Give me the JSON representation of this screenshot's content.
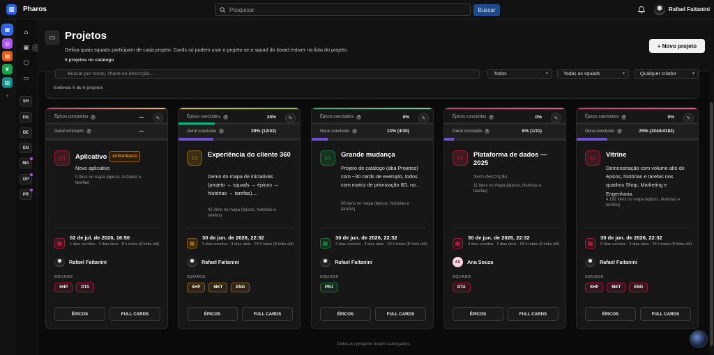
{
  "app": {
    "name": "Pharos"
  },
  "search": {
    "placeholder": "Pesquisar",
    "button_label": "Buscar"
  },
  "user": {
    "name": "Rafael Faitanini"
  },
  "squad_shortcuts": [
    {
      "label": "SH",
      "dot": false
    },
    {
      "label": "D&",
      "dot": false
    },
    {
      "label": "DE",
      "dot": false
    },
    {
      "label": "EN",
      "dot": false
    },
    {
      "label": "MA",
      "dot": true
    },
    {
      "label": "OP",
      "dot": true
    },
    {
      "label": "PR",
      "dot": true
    }
  ],
  "header": {
    "title": "Projetos",
    "description": "Defina quais squads participam de cada projeto. Cards só podem usar o projeto se a squad do board estiver na lista do projeto.",
    "count": "5 projetos no catálogo",
    "new_button": "+ Novo projeto"
  },
  "filters": {
    "search_placeholder": "Buscar por nome, chave ou descrição...",
    "status": "Todos",
    "squads": "Todas as squads",
    "owner": "Qualquer criador",
    "count_text": "Exibindo 5 de 5 projetos"
  },
  "labels": {
    "epics_done": "Épicos concluídos",
    "overall_done": "Geral concluído",
    "squads": "SQUADS",
    "epics_button": "ÉPICOS",
    "full_cards_button": "FULL CARDS"
  },
  "projects": [
    {
      "title": "Aplicativo",
      "badge": "ESTRATÉGICO",
      "epics_pct": "—",
      "epics_fill": 0,
      "overall_pct": "—",
      "overall_fill": 0,
      "description": "Novo aplicativo",
      "description_muted": false,
      "items": "0 itens no mapa (épicos, histórias e tarefas)",
      "date": "02 de jul. de 2026, 16:50",
      "date_sub": "1 dias corridos · 1 dias úteis · 8 h totais (8 h/dia útil)",
      "owner": "Rafael Faitanini",
      "owner_initials": "",
      "tags": [
        "SHP",
        "DTA"
      ],
      "accent": "#e11d48",
      "stripe": "linear-gradient(90deg,#b8456a,#e8b86a)"
    },
    {
      "title": "Experiência do cliente 360",
      "badge": "",
      "epics_pct": "30%",
      "epics_fill": 30,
      "overall_pct": "29% (12/42)",
      "overall_fill": 29,
      "description": "Demo do mapa de iniciativas (projeto → squads → épicos → histórias → tarefas)....",
      "description_muted": false,
      "items": "42 itens no mapa (épicos, histórias e tarefas)",
      "date": "30 de jun. de 2026, 22:32",
      "date_sub": "3 dias corridos · 3 dias úteis · 24 h totais (8 h/dia útil)",
      "owner": "Rafael Faitanini",
      "owner_initials": "",
      "tags": [
        "SHP",
        "MKT",
        "ENG"
      ],
      "accent": "#ca8a04",
      "stripe": "linear-gradient(90deg,#d6b84a,#8fb84a)"
    },
    {
      "title": "Grande mudança",
      "badge": "",
      "epics_pct": "0%",
      "epics_fill": 0,
      "overall_pct": "13% (4/30)",
      "overall_fill": 13,
      "description": "Projeto de catálogo (aba Projetos) com ~30 cards de exemplo, todos com matriz de priorização 8D, no...",
      "description_muted": false,
      "items": "30 itens no mapa (épicos, histórias e tarefas)",
      "date": "30 de jun. de 2026, 22:32",
      "date_sub": "3 dias corridos · 3 dias úteis · 24 h totais (8 h/dia útil)",
      "owner": "Rafael Faitanini",
      "owner_initials": "",
      "tags": [
        "PRJ"
      ],
      "accent": "#16a34a",
      "stripe": "linear-gradient(90deg,#3aa86a,#7ac8a0)"
    },
    {
      "title": "Plataforma de dados — 2025",
      "badge": "",
      "epics_pct": "0%",
      "epics_fill": 0,
      "overall_pct": "8% (1/11)",
      "overall_fill": 8,
      "description": "Sem descrição",
      "description_muted": true,
      "items": "11 itens no mapa (épicos, histórias e tarefas)",
      "date": "30 de jun. de 2026, 22:32",
      "date_sub": "3 dias corridos · 3 dias úteis · 24 h totais (8 h/dia útil)",
      "owner": "Ana Souza",
      "owner_initials": "AS",
      "tags": [
        "DTA"
      ],
      "accent": "#e11d48",
      "stripe": "linear-gradient(90deg,#c83a6a,#e85a8a)"
    },
    {
      "title": "Vitrine",
      "badge": "",
      "epics_pct": "0%",
      "epics_fill": 0,
      "overall_pct": "25% (1040/4182)",
      "overall_fill": 25,
      "description": "Demonstração com volume alto de épicos, histórias e tarefas nos quadros Shop, Marketing e Engenharia.",
      "description_muted": false,
      "items": "4.192 itens no mapa (épicos, histórias e tarefas)",
      "date": "30 de jun. de 2026, 22:32",
      "date_sub": "3 dias corridos · 3 dias úteis · 24 h totais (8 h/dia útil)",
      "owner": "Rafael Faitanini",
      "owner_initials": "",
      "tags": [
        "SHP",
        "MKT",
        "ENG"
      ],
      "accent": "#e11d48",
      "stripe": "linear-gradient(90deg,#c83a6a,#e85a8a)"
    }
  ],
  "footer": {
    "text": "Todos os projetos foram carregados."
  }
}
